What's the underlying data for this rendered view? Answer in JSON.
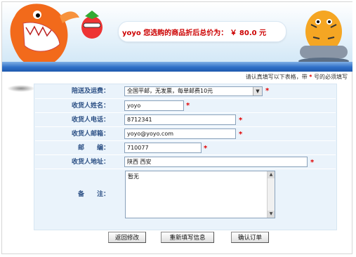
{
  "banner": {
    "price_label": "yoyo 您选购的商品折后总价为：",
    "price_value": "￥ 80.0 元"
  },
  "notice": {
    "text_before": "请认真填写以下表格，带",
    "star": "*",
    "text_after": "号的必须填写"
  },
  "form": {
    "shipping": {
      "label": "陪送及运费：",
      "value": "全国平邮，无发票，每单邮费10元"
    },
    "name": {
      "label": "收货人姓名：",
      "value": "yoyo"
    },
    "phone": {
      "label": "收货人电话：",
      "value": "8712341"
    },
    "email": {
      "label": "收货人邮箱：",
      "value": "yoyo@yoyo.com"
    },
    "postcode": {
      "label": "邮　　编：",
      "value": "710077"
    },
    "address": {
      "label": "收货人地址：",
      "value": "陕西 西安"
    },
    "remark": {
      "label": "备　　注：",
      "value": "暂无"
    },
    "required_mark": "*"
  },
  "buttons": {
    "back": "返回修改",
    "refill": "重新填写信息",
    "confirm": "确认订单"
  },
  "colors": {
    "accent_blue": "#2f6fc8",
    "label_blue": "#2b4f84",
    "required_red": "#e00000",
    "form_bg": "#eaf3fb"
  }
}
